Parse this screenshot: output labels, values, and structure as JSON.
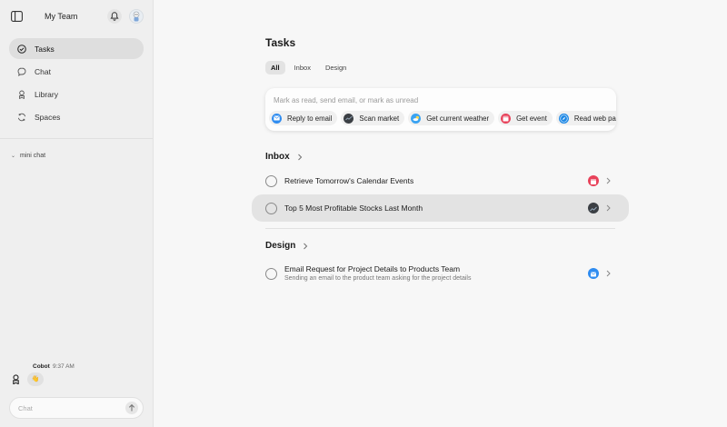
{
  "sidebar": {
    "team_name": "My Team",
    "nav": [
      {
        "label": "Tasks",
        "icon": "check-circle-icon",
        "active": true
      },
      {
        "label": "Chat",
        "icon": "chat-bubble-icon",
        "active": false
      },
      {
        "label": "Library",
        "icon": "library-icon",
        "active": false
      },
      {
        "label": "Spaces",
        "icon": "spaces-icon",
        "active": false
      }
    ],
    "mini_chat_label": "mini chat",
    "cobot": {
      "name": "Cobot",
      "time": "9:37 AM",
      "emoji": "👋"
    },
    "chat_placeholder": "Chat"
  },
  "main": {
    "title": "Tasks",
    "tabs": [
      {
        "label": "All",
        "active": true
      },
      {
        "label": "Inbox",
        "active": false
      },
      {
        "label": "Design",
        "active": false
      }
    ],
    "composer": {
      "placeholder": "Mark as read, send email, or mark as unread",
      "chips": [
        {
          "label": "Reply to email",
          "icon": "mail-app-icon"
        },
        {
          "label": "Scan market",
          "icon": "stocks-app-icon"
        },
        {
          "label": "Get current weather",
          "icon": "weather-app-icon"
        },
        {
          "label": "Get event",
          "icon": "calendar-app-icon"
        },
        {
          "label": "Read web page",
          "icon": "safari-app-icon"
        }
      ]
    },
    "sections": [
      {
        "name": "Inbox",
        "tasks": [
          {
            "title": "Retrieve Tomorrow's Calendar Events",
            "subtitle": "",
            "app_icon": "calendar-app-icon"
          },
          {
            "title": "Top 5 Most Profitable Stocks Last Month",
            "subtitle": "",
            "app_icon": "stocks-app-icon"
          }
        ]
      },
      {
        "name": "Design",
        "tasks": [
          {
            "title": "Email Request for Project Details to Products Team",
            "subtitle": "Sending an email to the product team asking for the project details",
            "app_icon": "mail-app-icon"
          }
        ]
      }
    ]
  },
  "colors": {
    "sidebar_bg": "#efefef",
    "main_bg": "#f7f7f7",
    "active_nav": "#dedede",
    "mail_blue": "#2f8cf0",
    "calendar_red": "#e8425a",
    "stocks_dark": "#3b3f44"
  }
}
